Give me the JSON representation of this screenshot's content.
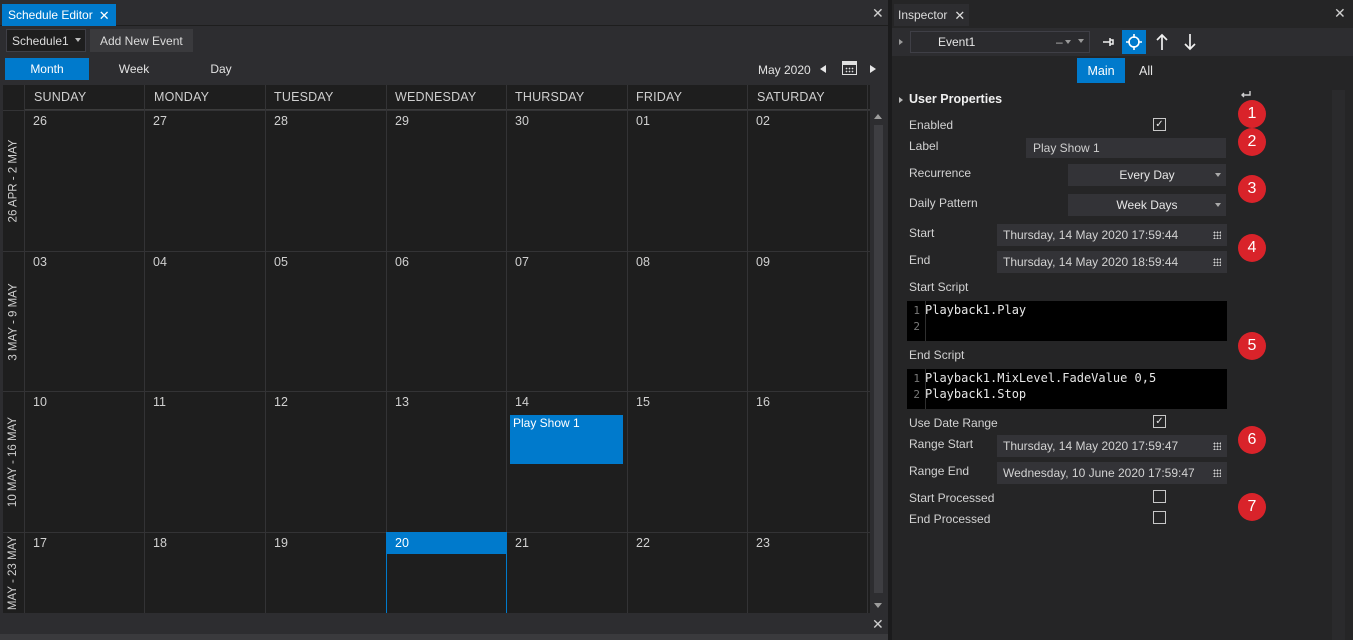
{
  "schedule_editor": {
    "tab_title": "Schedule Editor",
    "close_glyph": "✕",
    "schedule_select": "Schedule1",
    "add_event_label": "Add New Event",
    "views": [
      "Month",
      "Week",
      "Day"
    ],
    "active_view": "Month",
    "current_month": "May 2020",
    "day_names": [
      "SUNDAY",
      "MONDAY",
      "TUESDAY",
      "WEDNESDAY",
      "THURSDAY",
      "FRIDAY",
      "SATURDAY"
    ],
    "weeks": [
      {
        "label": "26 APR - 2 MAY",
        "days": [
          "26",
          "27",
          "28",
          "29",
          "30",
          "01",
          "02"
        ]
      },
      {
        "label": "3 MAY - 9 MAY",
        "days": [
          "03",
          "04",
          "05",
          "06",
          "07",
          "08",
          "09"
        ]
      },
      {
        "label": "10 MAY - 16 MAY",
        "days": [
          "10",
          "11",
          "12",
          "13",
          "14",
          "15",
          "16"
        ]
      },
      {
        "label": "MAY - 23 MAY",
        "days": [
          "17",
          "18",
          "19",
          "20",
          "21",
          "22",
          "23"
        ]
      }
    ],
    "today": "20",
    "event": {
      "label": "Play Show 1",
      "day": "14"
    }
  },
  "inspector": {
    "tab_title": "Inspector",
    "close_glyph": "✕",
    "event_select": "Event1",
    "minus_glyph": "–",
    "tabs": [
      "Main",
      "All"
    ],
    "active_tab": "Main",
    "section_title": "User Properties",
    "properties": {
      "enabled_label": "Enabled",
      "enabled": true,
      "label_label": "Label",
      "label_value": "Play Show 1",
      "recurrence_label": "Recurrence",
      "recurrence_value": "Every Day",
      "daily_pattern_label": "Daily Pattern",
      "daily_pattern_value": "Week Days",
      "start_label": "Start",
      "start_value": "Thursday, 14 May 2020 17:59:44",
      "end_label": "End",
      "end_value": "Thursday, 14 May 2020 18:59:44",
      "start_script_label": "Start Script",
      "start_script": [
        "Playback1.Play",
        ""
      ],
      "end_script_label": "End Script",
      "end_script": [
        "Playback1.MixLevel.FadeValue 0,5",
        "Playback1.Stop"
      ],
      "use_date_range_label": "Use Date Range",
      "use_date_range": true,
      "range_start_label": "Range Start",
      "range_start_value": "Thursday, 14 May 2020 17:59:47",
      "range_end_label": "Range End",
      "range_end_value": "Wednesday, 10 June 2020 17:59:47",
      "start_processed_label": "Start Processed",
      "start_processed": false,
      "end_processed_label": "End Processed",
      "end_processed": false
    },
    "badges": [
      "1",
      "2",
      "3",
      "4",
      "5",
      "6",
      "7"
    ]
  },
  "colors": {
    "accent": "#007acc",
    "badge": "#d9232a",
    "panel": "#2d2d30",
    "background": "#1e1e1e"
  }
}
